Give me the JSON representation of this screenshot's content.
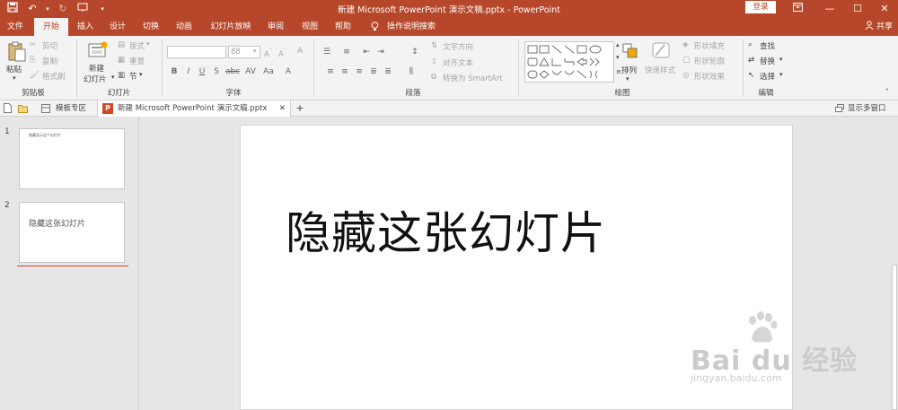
{
  "titlebar": {
    "title": "新建 Microsoft PowerPoint 演示文稿.pptx  -  PowerPoint",
    "login_label": "登录",
    "colors": {
      "accent": "#b7472a"
    }
  },
  "tabs": [
    "文件",
    "开始",
    "插入",
    "设计",
    "切换",
    "动画",
    "幻灯片放映",
    "审阅",
    "视图",
    "帮助"
  ],
  "tell_me": "操作说明搜索",
  "share_label": "共享",
  "ribbon": {
    "clipboard": {
      "paste": "粘贴",
      "cut": "剪切",
      "copy": "复制",
      "format_painter": "格式刷",
      "label": "剪贴板"
    },
    "slides": {
      "new_slide_line1": "新建",
      "new_slide_line2": "幻灯片",
      "layout": "版式",
      "reset": "重置",
      "section": "节",
      "label": "幻灯片"
    },
    "font": {
      "size_value": "88",
      "label": "字体"
    },
    "paragraph": {
      "text_direction": "文字方向",
      "align_text": "对齐文本",
      "convert_smartart": "转换为 SmartArt",
      "label": "段落"
    },
    "drawing": {
      "arrange": "排列",
      "quick_styles": "快速样式",
      "shape_fill": "形状填充",
      "shape_outline": "形状轮廓",
      "shape_effects": "形状效果",
      "label": "绘图"
    },
    "editing": {
      "find": "查找",
      "replace": "替换",
      "select": "选择",
      "label": "编辑"
    }
  },
  "docbar": {
    "template_tab": "模板专区",
    "doc_tab": "新建 Microsoft PowerPoint 演示文稿.pptx",
    "float_window": "显示多窗口"
  },
  "slides": [
    {
      "number": "1",
      "thumb_text": "隐藏显示这个幻灯片"
    },
    {
      "number": "2",
      "thumb_text": "隐藏这张幻灯片"
    }
  ],
  "current_slide": {
    "title": "隐藏这张幻灯片"
  },
  "watermark": {
    "brand": "Bai du 经验",
    "url": "jingyan.baidu.com"
  }
}
